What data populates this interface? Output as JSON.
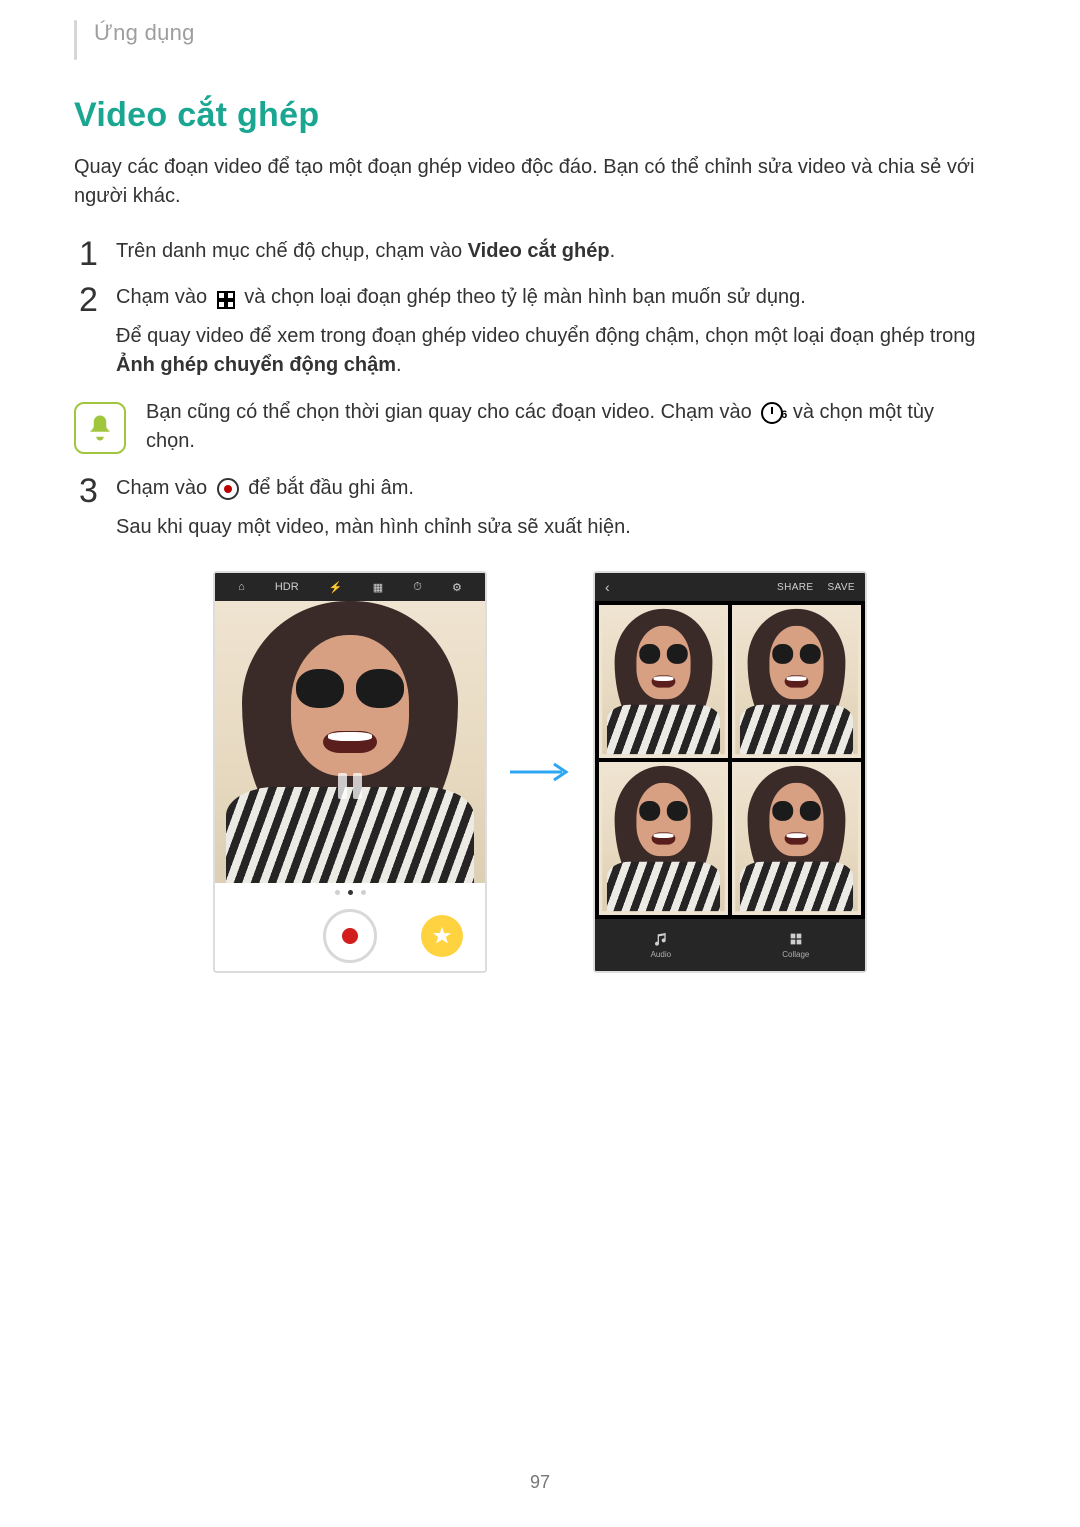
{
  "section_label": "Ứng dụng",
  "title": "Video cắt ghép",
  "intro": "Quay các đoạn video để tạo một đoạn ghép video độc đáo. Bạn có thể chỉnh sửa video và chia sẻ với người khác.",
  "step1_a": "Trên danh mục chế độ chụp, chạm vào ",
  "step1_b": "Video cắt ghép",
  "step1_c": ".",
  "step2_a": "Chạm vào ",
  "step2_b": " và chọn loại đoạn ghép theo tỷ lệ màn hình bạn muốn sử dụng.",
  "step2_cont_a": "Để quay video để xem trong đoạn ghép video chuyển động chậm, chọn một loại đoạn ghép trong ",
  "step2_cont_b": "Ảnh ghép chuyển động chậm",
  "step2_cont_c": ".",
  "tip_a": "Bạn cũng có thể chọn thời gian quay cho các đoạn video. Chạm vào ",
  "tip_b": " và chọn một tùy chọn.",
  "step3_a": "Chạm vào ",
  "step3_b": " để bắt đầu ghi âm.",
  "step3_cont": "Sau khi quay một video, màn hình chỉnh sửa sẽ xuất hiện.",
  "phone1_topbar": {
    "i1": "⌂",
    "i2": "HDR",
    "i3": "⚡",
    "i4": "▦",
    "i5": "⏱",
    "i6": "⚙"
  },
  "phone2": {
    "back": "‹",
    "share": "SHARE",
    "save": "SAVE",
    "audio": "Audio",
    "collage": "Collage"
  },
  "page_number": "97"
}
